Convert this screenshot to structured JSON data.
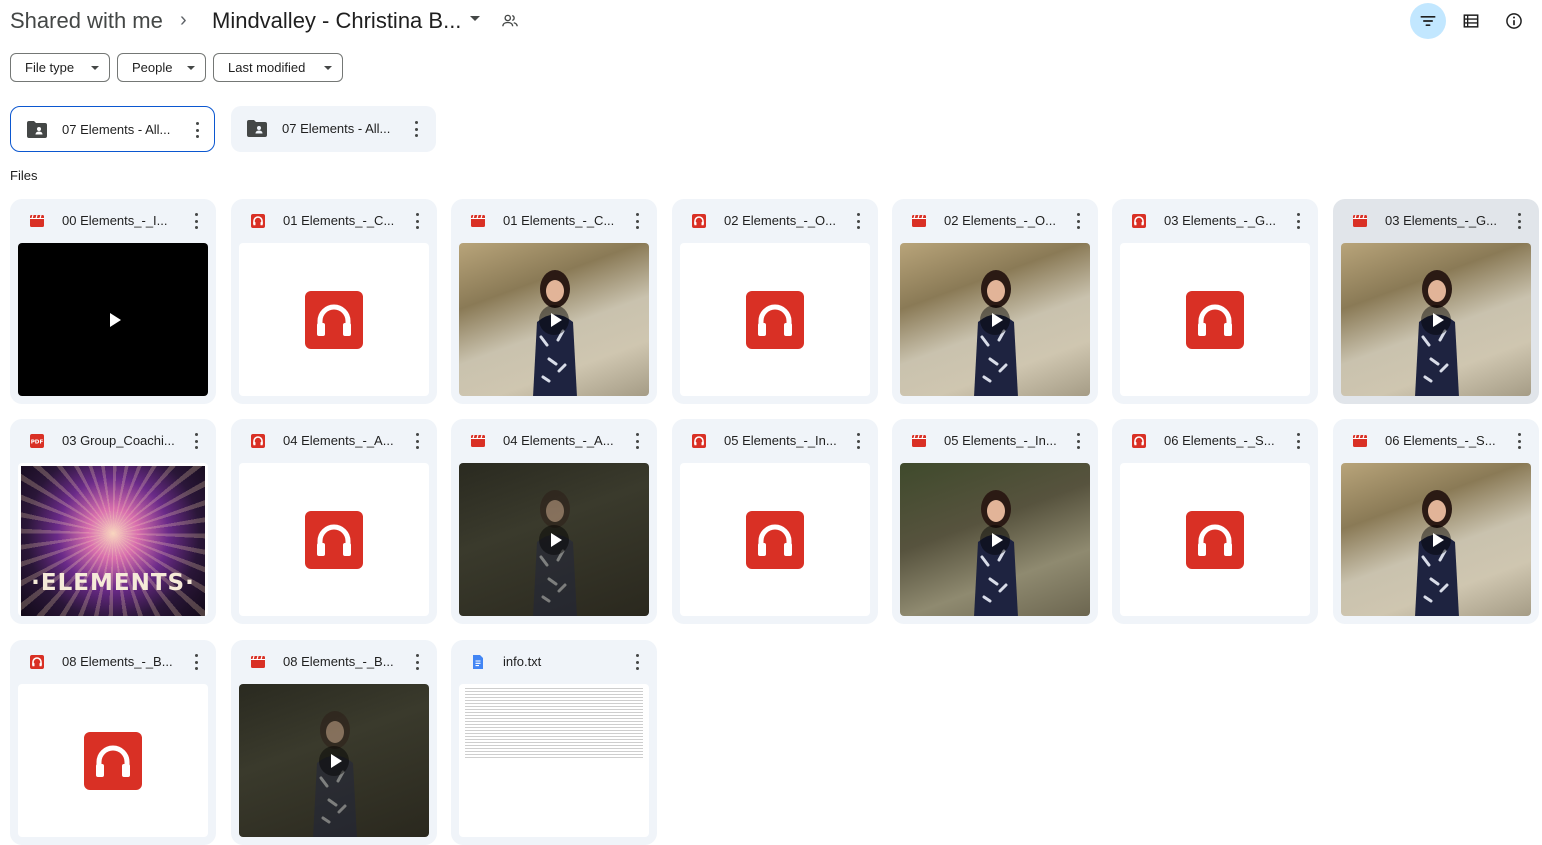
{
  "header": {
    "root_crumb": "Shared with me",
    "separator": "›",
    "current_folder": "Mindvalley - Christina B...",
    "actions": [
      {
        "name": "filter-icon",
        "active": true
      },
      {
        "name": "list-view-icon",
        "active": false
      },
      {
        "name": "info-icon",
        "active": false
      }
    ]
  },
  "filters": [
    {
      "label": "File type"
    },
    {
      "label": "People"
    },
    {
      "label": "Last modified"
    }
  ],
  "folders": [
    {
      "name": "07 Elements - All...",
      "icon": "shared-folder-icon",
      "selected": true
    },
    {
      "name": "07 Elements - All...",
      "icon": "shared-folder-icon",
      "selected": false
    }
  ],
  "files_label": "Files",
  "files": [
    {
      "name": "00 Elements_-_I...",
      "type": "video",
      "thumb": "black"
    },
    {
      "name": "01 Elements_-_C...",
      "type": "audio",
      "thumb": "audio"
    },
    {
      "name": "01 Elements_-_C...",
      "type": "video",
      "thumb": "video"
    },
    {
      "name": "02 Elements_-_O...",
      "type": "audio",
      "thumb": "audio"
    },
    {
      "name": "02 Elements_-_O...",
      "type": "video",
      "thumb": "video"
    },
    {
      "name": "03 Elements_-_G...",
      "type": "audio",
      "thumb": "audio"
    },
    {
      "name": "03 Elements_-_G...",
      "type": "video",
      "thumb": "video"
    },
    {
      "name": "03 Group_Coachi...",
      "type": "pdf",
      "thumb": "pdf",
      "thumb_text": "ELEMENTS"
    },
    {
      "name": "04 Elements_-_A...",
      "type": "audio",
      "thumb": "audio"
    },
    {
      "name": "04 Elements_-_A...",
      "type": "video",
      "thumb": "video-dark"
    },
    {
      "name": "05 Elements_-_In...",
      "type": "audio",
      "thumb": "audio"
    },
    {
      "name": "05 Elements_-_In...",
      "type": "video",
      "thumb": "video-mid"
    },
    {
      "name": "06 Elements_-_S...",
      "type": "audio",
      "thumb": "audio"
    },
    {
      "name": "06 Elements_-_S...",
      "type": "video",
      "thumb": "video"
    },
    {
      "name": "08 Elements_-_B...",
      "type": "audio",
      "thumb": "audio"
    },
    {
      "name": "08 Elements_-_B...",
      "type": "video",
      "thumb": "video-dark"
    },
    {
      "name": "info.txt",
      "type": "doc",
      "thumb": "text"
    }
  ],
  "colors": {
    "accent": "#0b57d0",
    "active_chip_bg": "#c2e7ff",
    "card_bg": "#f0f4f9",
    "audio_red": "#d93025"
  }
}
